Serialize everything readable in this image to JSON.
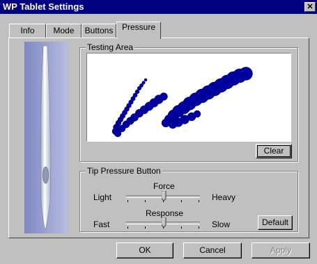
{
  "window": {
    "title": "WP Tablet Settings",
    "close_label": "✕"
  },
  "tabs": [
    {
      "label": "Info"
    },
    {
      "label": "Mode"
    },
    {
      "label": "Buttons"
    },
    {
      "label": "Pressure"
    }
  ],
  "testing_area": {
    "label": "Testing Area",
    "clear_label": "Clear"
  },
  "tip_pressure": {
    "label": "Tip Pressure Button",
    "force": {
      "title": "Force",
      "min_label": "Light",
      "max_label": "Heavy",
      "value": 0.5
    },
    "response": {
      "title": "Response",
      "min_label": "Fast",
      "max_label": "Slow",
      "value": 0.5
    },
    "default_label": "Default"
  },
  "footer": {
    "ok_label": "OK",
    "cancel_label": "Cancel",
    "apply_label": "Apply"
  },
  "colors": {
    "stroke": "#00008b",
    "title_bar": "#000080",
    "pen_background": "#a8b0d8"
  }
}
